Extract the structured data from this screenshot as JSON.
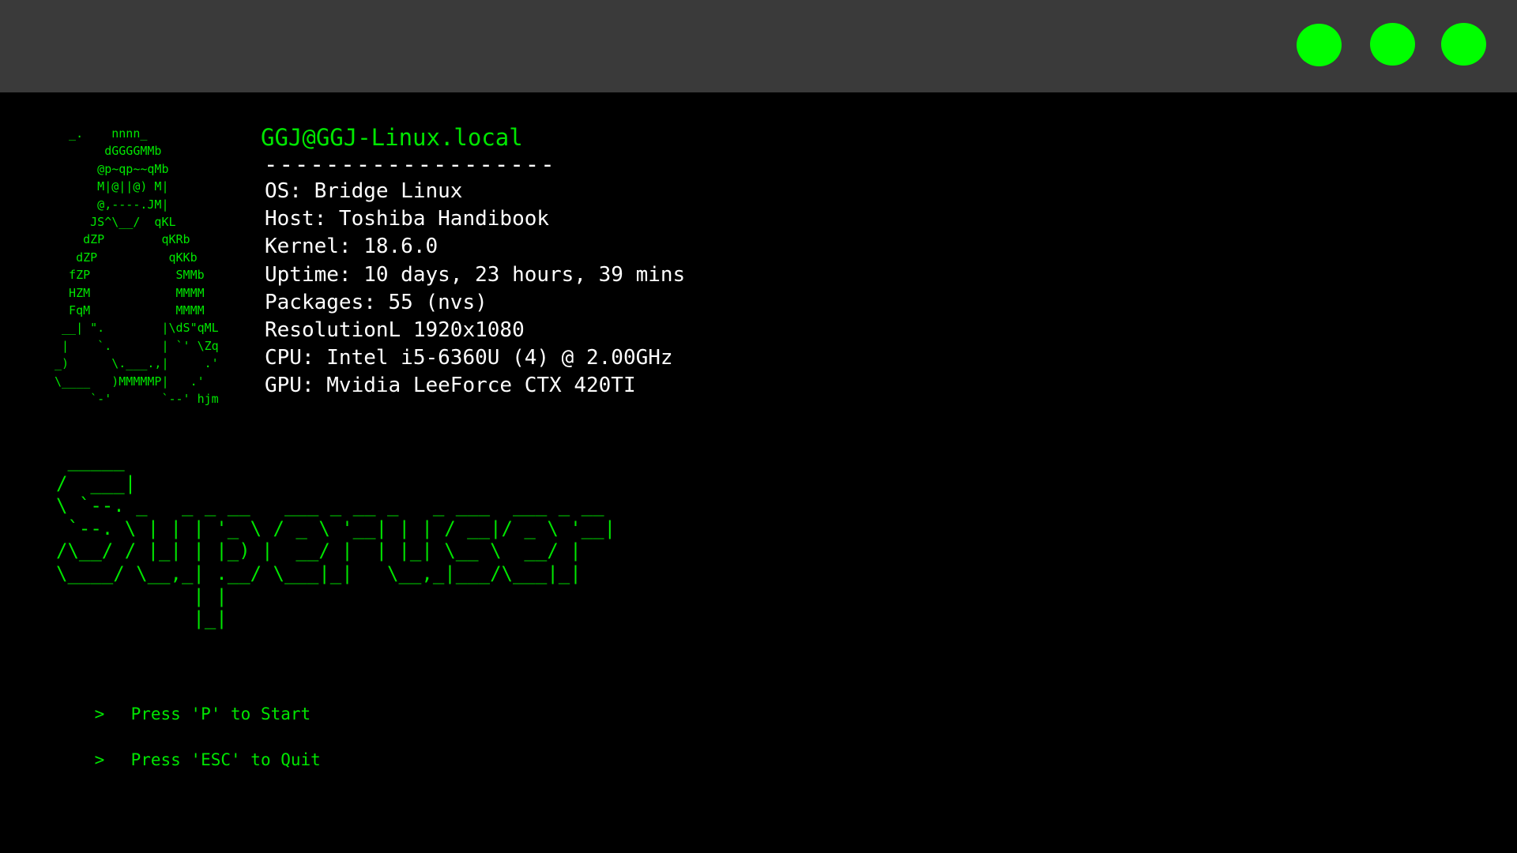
{
  "window": {
    "title_bar_buttons": [
      "green-dot",
      "green-dot",
      "green-dot"
    ],
    "accent_color": "#00ff00",
    "background_color": "#000000",
    "titlebar_color": "#3a3a3a"
  },
  "logo_art": "  _.    nnnn_\n       dGGGGMMb\n      @p~qp~~qMb\n      M|@||@) M|\n      @,----.JM|\n     JS^\\__/  qKL\n    dZP        qKRb\n   dZP          qKKb\n  fZP            SMMb\n  HZM            MMMM\n  FqM            MMMM\n __| \".        |\\dS\"qML\n |    `.       | `' \\Zq\n_)      \\.___.,|     .'\n\\____   )MMMMMP|   .'\n     `-'       `--' hjm",
  "sysinfo": {
    "hostname": "GGJ@GGJ-Linux.local",
    "separator": "-------------------",
    "lines": [
      "OS: Bridge Linux",
      "Host: Toshiba Handibook",
      "Kernel: 18.6.0",
      "Uptime: 10 days, 23 hours, 39 mins",
      "Packages: 55 (nvs)",
      "ResolutionL 1920x1080",
      "CPU: Intel i5-6360U (4) @ 2.00GHz",
      "GPU: Mvidia LeeForce CTX 420TI"
    ]
  },
  "title_art": " _____\n/  ___|\n\\ `--. _   _ _ __   ___ _ __ _   _ ___  ___ _ __\n `--. \\ | | | '_ \\ / _ \\ '__| | | / __|/ _ \\ '__|\n/\\__/ / |_| | |_) |  __/ |  | |_| \\__ \\  __/ |\n\\____/ \\__,_| .__/ \\___|_|   \\__,_|___/\\___|_|\n            | |\n            |_|",
  "menu": {
    "prompt_symbol": ">",
    "start_label": "Press 'P' to Start",
    "quit_label": "Press 'ESC' to Quit"
  }
}
